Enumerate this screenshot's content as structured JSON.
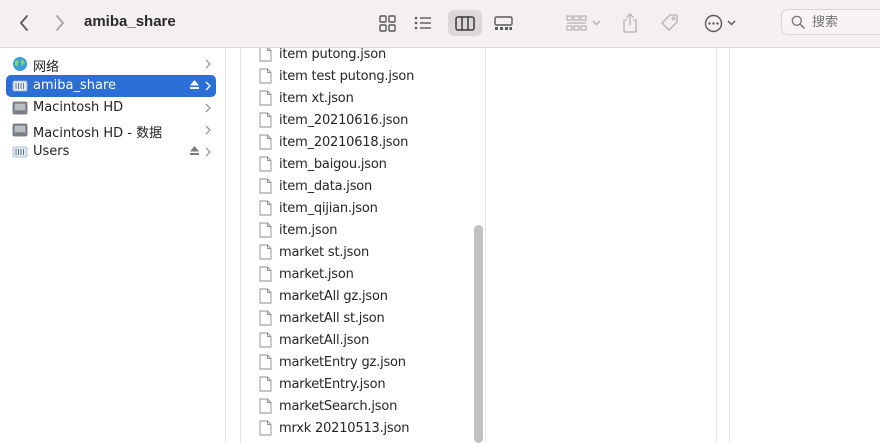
{
  "window": {
    "title": "amiba_share"
  },
  "toolbar": {
    "search_placeholder": "搜索"
  },
  "sidebar": {
    "items": [
      {
        "label": "网络",
        "icon": "globe-icon",
        "eject": false,
        "selected": false
      },
      {
        "label": "amiba_share",
        "icon": "server-icon",
        "eject": true,
        "selected": true
      },
      {
        "label": "Macintosh HD",
        "icon": "harddisk-icon",
        "eject": false,
        "selected": false
      },
      {
        "label": "Macintosh HD - 数据",
        "icon": "harddisk-icon",
        "eject": false,
        "selected": false
      },
      {
        "label": "Users",
        "icon": "server-icon",
        "eject": true,
        "selected": false
      }
    ]
  },
  "files": [
    "item putong.json",
    "item test putong.json",
    "item xt.json",
    "item_20210616.json",
    "item_20210618.json",
    "item_baigou.json",
    "item_data.json",
    "item_qijian.json",
    "item.json",
    "market st.json",
    "market.json",
    "marketAll gz.json",
    "marketAll st.json",
    "marketAll.json",
    "marketEntry gz.json",
    "marketEntry.json",
    "marketSearch.json",
    "mrxk 20210513.json"
  ],
  "colors": {
    "accent": "#2a6ed6",
    "toolbar_bg": "#f4eff3"
  }
}
